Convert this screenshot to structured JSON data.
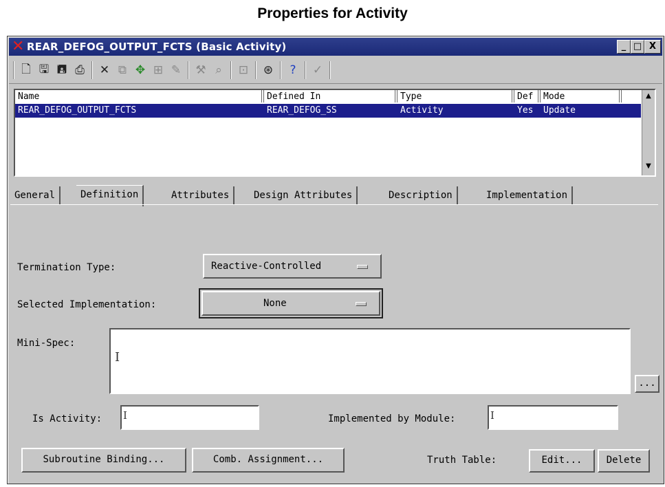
{
  "caption": "Properties for Activity",
  "window": {
    "title": "REAR_DEFOG_OUTPUT_FCTS (Basic Activity)",
    "minimize": "_",
    "maximize": "□",
    "close": "X"
  },
  "toolbar": {
    "icons": [
      "new-icon",
      "save-icon",
      "save-all-icon",
      "print-icon",
      "cut-icon",
      "copy-icon",
      "paste-icon",
      "duplicate-icon",
      "edit-icon",
      "tools-icon",
      "find-icon",
      "browse-icon",
      "binoculars-icon",
      "help-icon",
      "check-icon"
    ]
  },
  "list": {
    "columns": [
      "Name",
      "Defined In",
      "Type",
      "Def",
      "Mode"
    ],
    "rows": [
      {
        "name": "REAR_DEFOG_OUTPUT_FCTS",
        "defined_in": "REAR_DEFOG_SS",
        "type": "Activity",
        "def": "Yes",
        "mode": "Update"
      }
    ]
  },
  "tabs": [
    "General",
    "Definition",
    "Attributes",
    "Design Attributes",
    "Description",
    "Implementation"
  ],
  "active_tab": "Definition",
  "form": {
    "termination_label": "Termination Type:",
    "termination_value": "Reactive-Controlled",
    "implementation_label": "Selected Implementation:",
    "implementation_value": "None",
    "minispec_label": "Mini-Spec:",
    "minispec_cursor": "I",
    "ellipsis": "...",
    "is_activity_label": "Is Activity:",
    "is_activity_value": "",
    "implemented_by_label": "Implemented by Module:",
    "implemented_by_value": ""
  },
  "buttons": {
    "subroutine": "Subroutine Binding...",
    "comb": "Comb. Assignment...",
    "truth_table_label": "Truth Table:",
    "edit": "Edit...",
    "delete": "Delete"
  },
  "colors": {
    "title_bar": "#1b2a78",
    "selection": "#1c1e8c",
    "face": "#c6c6c6"
  }
}
